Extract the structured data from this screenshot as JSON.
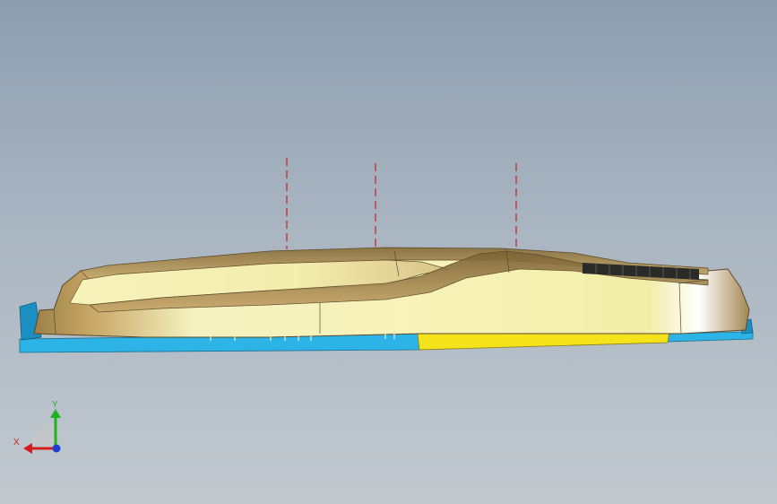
{
  "viewport": {
    "background_top": "#8e9eb0",
    "background_bottom": "#c2c9cf"
  },
  "model": {
    "body_color": "#f3efb2",
    "body_shade_color": "#b89a55",
    "body_edge_color": "#5a4a2a",
    "base_plate_color": "#2db4e6",
    "insert_plate_color": "#f4e21a",
    "teeth_color": "#2a2a28",
    "section_line_color": "#cc1f1f",
    "section_line_count": 3
  },
  "triad": {
    "x_label": "X",
    "y_label": "Y",
    "x_color": "#d21e1e",
    "y_color": "#22b021",
    "z_color": "#1e3cd2"
  }
}
